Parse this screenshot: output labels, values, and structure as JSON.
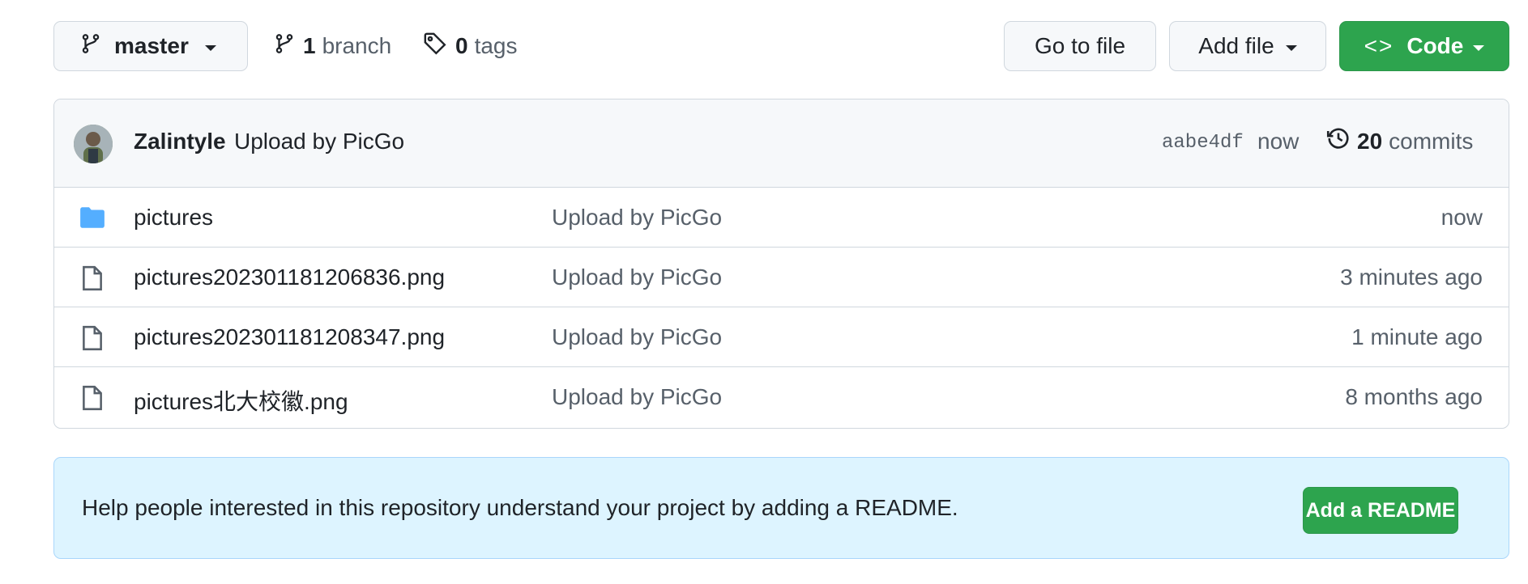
{
  "toolbar": {
    "branch_label": "master",
    "branch_count": "1",
    "branch_word": "branch",
    "tag_count": "0",
    "tag_word": "tags",
    "goto_file": "Go to file",
    "add_file": "Add file",
    "code": "Code",
    "code_glyph": "<>"
  },
  "commit": {
    "author": "Zalintyle",
    "message": "Upload by PicGo",
    "sha": "aabe4df",
    "time": "now",
    "commit_count": "20",
    "commit_word": "commits"
  },
  "files": [
    {
      "type": "folder",
      "name": "pictures",
      "commit": "Upload by PicGo",
      "age": "now"
    },
    {
      "type": "file",
      "name": "pictures202301181206836.png",
      "commit": "Upload by PicGo",
      "age": "3 minutes ago"
    },
    {
      "type": "file",
      "name": "pictures202301181208347.png",
      "commit": "Upload by PicGo",
      "age": "1 minute ago"
    },
    {
      "type": "file",
      "name": "pictures北大校徽.png",
      "commit": "Upload by PicGo",
      "age": "8 months ago"
    }
  ],
  "readme": {
    "text": "Help people interested in this repository understand your project by adding a README.",
    "button": "Add a README"
  },
  "colors": {
    "primary_green": "#2da44e",
    "folder_blue": "#54aeff",
    "readme_bg": "#ddf4ff"
  }
}
